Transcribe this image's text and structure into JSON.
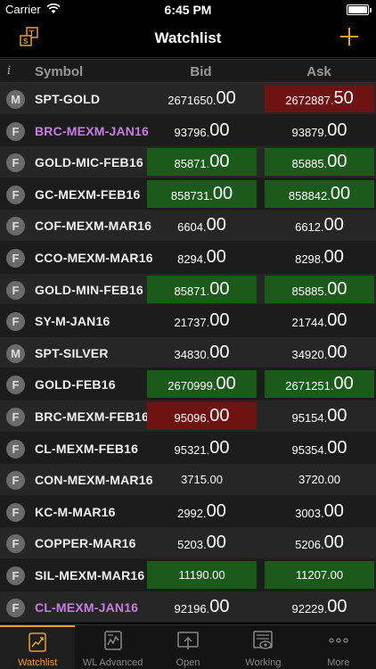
{
  "status": {
    "carrier": "Carrier",
    "time": "6:45 PM"
  },
  "nav": {
    "title": "Watchlist"
  },
  "columns": {
    "info": "i",
    "symbol": "Symbol",
    "bid": "Bid",
    "ask": "Ask"
  },
  "rows": [
    {
      "type": "M",
      "symbol": "SPT-GOLD",
      "purple": false,
      "bid": {
        "main": "2671650.",
        "dec": "00",
        "hl": ""
      },
      "ask": {
        "main": "2672887.",
        "dec": "50",
        "hl": "red"
      }
    },
    {
      "type": "F",
      "symbol": "BRC-MEXM-JAN16",
      "purple": true,
      "bid": {
        "main": "93796.",
        "dec": "00",
        "hl": ""
      },
      "ask": {
        "main": "93879.",
        "dec": "00",
        "hl": ""
      }
    },
    {
      "type": "F",
      "symbol": "GOLD-MIC-FEB16",
      "purple": false,
      "bid": {
        "main": "85871.",
        "dec": "00",
        "hl": "green"
      },
      "ask": {
        "main": "85885.",
        "dec": "00",
        "hl": "green"
      }
    },
    {
      "type": "F",
      "symbol": "GC-MEXM-FEB16",
      "purple": false,
      "bid": {
        "main": "858731.",
        "dec": "00",
        "hl": "green"
      },
      "ask": {
        "main": "858842.",
        "dec": "00",
        "hl": "green"
      }
    },
    {
      "type": "F",
      "symbol": "COF-MEXM-MAR16",
      "purple": false,
      "bid": {
        "main": "6604.",
        "dec": "00",
        "hl": ""
      },
      "ask": {
        "main": "6612.",
        "dec": "00",
        "hl": ""
      }
    },
    {
      "type": "F",
      "symbol": "CCO-MEXM-MAR16",
      "purple": false,
      "bid": {
        "main": "8294.",
        "dec": "00",
        "hl": ""
      },
      "ask": {
        "main": "8298.",
        "dec": "00",
        "hl": ""
      }
    },
    {
      "type": "F",
      "symbol": "GOLD-MIN-FEB16",
      "purple": false,
      "bid": {
        "main": "85871.",
        "dec": "00",
        "hl": "green"
      },
      "ask": {
        "main": "85885.",
        "dec": "00",
        "hl": "green"
      }
    },
    {
      "type": "F",
      "symbol": "SY-M-JAN16",
      "purple": false,
      "bid": {
        "main": "21737.",
        "dec": "00",
        "hl": ""
      },
      "ask": {
        "main": "21744.",
        "dec": "00",
        "hl": ""
      }
    },
    {
      "type": "M",
      "symbol": "SPT-SILVER",
      "purple": false,
      "bid": {
        "main": "34830.",
        "dec": "00",
        "hl": ""
      },
      "ask": {
        "main": "34920.",
        "dec": "00",
        "hl": ""
      }
    },
    {
      "type": "F",
      "symbol": "GOLD-FEB16",
      "purple": false,
      "bid": {
        "main": "2670999.",
        "dec": "00",
        "hl": "green"
      },
      "ask": {
        "main": "2671251.",
        "dec": "00",
        "hl": "green"
      }
    },
    {
      "type": "F",
      "symbol": "BRC-MEXM-FEB16",
      "purple": false,
      "bid": {
        "main": "95096.",
        "dec": "00",
        "hl": "red"
      },
      "ask": {
        "main": "95154.",
        "dec": "00",
        "hl": ""
      }
    },
    {
      "type": "F",
      "symbol": "CL-MEXM-FEB16",
      "purple": false,
      "bid": {
        "main": "95321.",
        "dec": "00",
        "hl": ""
      },
      "ask": {
        "main": "95354.",
        "dec": "00",
        "hl": ""
      }
    },
    {
      "type": "F",
      "symbol": "CON-MEXM-MAR16",
      "purple": false,
      "bid": {
        "plain": "3715.00",
        "hl": ""
      },
      "ask": {
        "plain": "3720.00",
        "hl": ""
      }
    },
    {
      "type": "F",
      "symbol": "KC-M-MAR16",
      "purple": false,
      "bid": {
        "main": "2992.",
        "dec": "00",
        "hl": ""
      },
      "ask": {
        "main": "3003.",
        "dec": "00",
        "hl": ""
      }
    },
    {
      "type": "F",
      "symbol": "COPPER-MAR16",
      "purple": false,
      "bid": {
        "main": "5203.",
        "dec": "00",
        "hl": ""
      },
      "ask": {
        "main": "5206.",
        "dec": "00",
        "hl": ""
      }
    },
    {
      "type": "F",
      "symbol": "SIL-MEXM-MAR16",
      "purple": false,
      "bid": {
        "plain": "11190.00",
        "hl": "green"
      },
      "ask": {
        "plain": "11207.00",
        "hl": "green"
      }
    },
    {
      "type": "F",
      "symbol": "CL-MEXM-JAN16",
      "purple": true,
      "bid": {
        "main": "92196.",
        "dec": "00",
        "hl": ""
      },
      "ask": {
        "main": "92229.",
        "dec": "00",
        "hl": ""
      }
    }
  ],
  "tabs": [
    {
      "label": "Watchlist",
      "icon": "watchlist-chart-icon",
      "active": true
    },
    {
      "label": "WL Advanced",
      "icon": "advanced-chart-icon",
      "active": false
    },
    {
      "label": "Open",
      "icon": "open-orders-icon",
      "active": false
    },
    {
      "label": "Working",
      "icon": "working-orders-icon",
      "active": false
    },
    {
      "label": "More",
      "icon": "more-dots-icon",
      "active": false
    }
  ],
  "colors": {
    "accent": "#e8a020",
    "green": "#1c5a1c",
    "red": "#6e1212",
    "purple": "#c77ee0"
  }
}
